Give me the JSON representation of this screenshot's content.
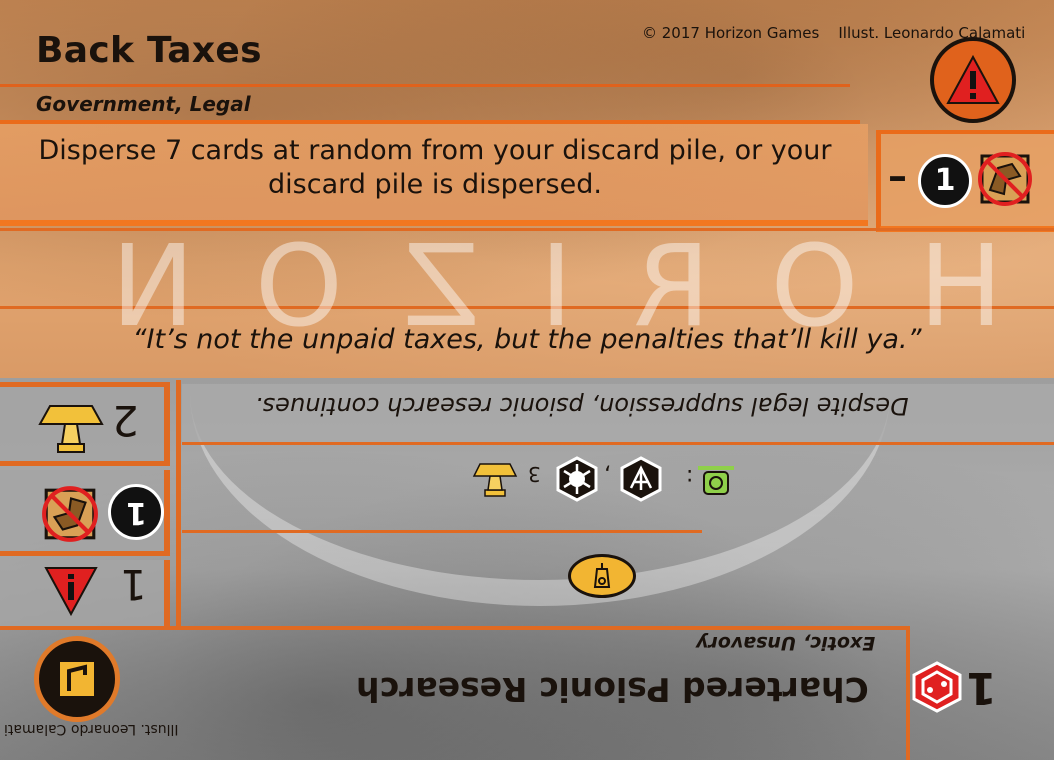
{
  "top": {
    "title": "Back Taxes",
    "copyright": "© 2017 Horizon Games    Illust. Leonardo Calamati",
    "subtypes": "Government, Legal",
    "text": "Disperse 7 cards at random from your discard pile, or your discard pile is dispersed.",
    "cost_dash": "–",
    "cost_number": "1",
    "flavor": "“It’s not the unpaid taxes, but the penalties that’ll kill ya.”",
    "watermark": "HORIZON",
    "icons": {
      "type_icon": "alert-triangle-icon",
      "cost_icon": "no-discard-icon"
    }
  },
  "bottom": {
    "title": "Chartered Psionic Research",
    "subtypes": "Exotic, Unsavory",
    "illustrator": "Illust. Leonardo Calamati",
    "cost": "1",
    "flavor": "Despite legal suppression, psionic research continues.",
    "ability_number": "3",
    "ability_separator": ",",
    "ability_colon": ":",
    "side_stats": [
      {
        "value": "2",
        "icon": "trophy-icon"
      },
      {
        "value": "1",
        "icon": "no-discard-icon"
      },
      {
        "value": "1",
        "icon": "priority-arrow-icon"
      }
    ],
    "icons": {
      "faction_icon": "hazard-icon",
      "cost_icon": "hex-symbol-icon",
      "influence_icon": "influence-icon"
    }
  },
  "colors": {
    "orange": "#e06a22",
    "accent_red": "#e02020",
    "gold": "#f2b532"
  }
}
